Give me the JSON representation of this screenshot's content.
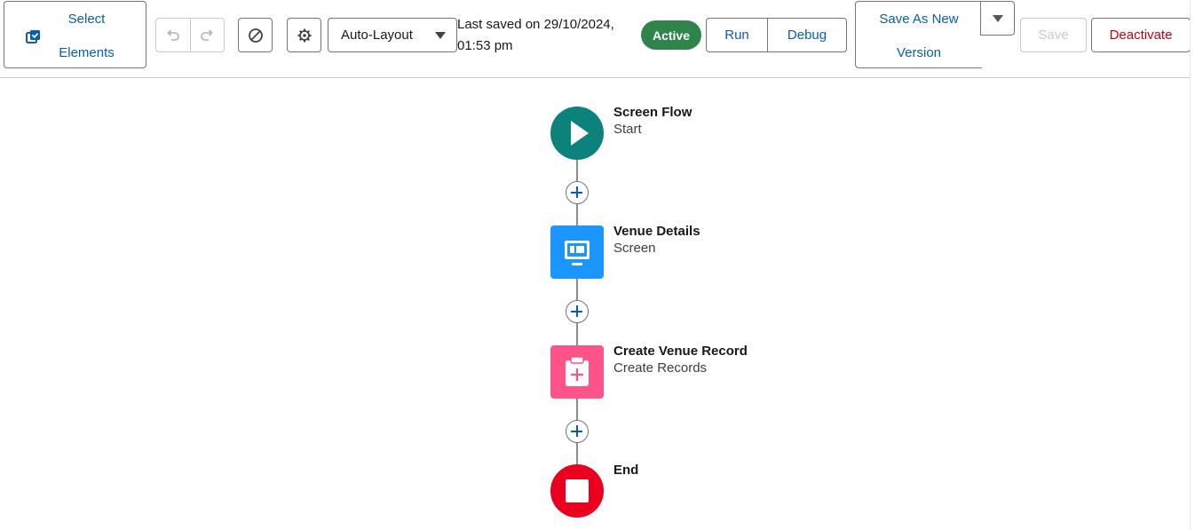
{
  "toolbar": {
    "select_elements": {
      "line1": "Select",
      "line2": "Elements"
    },
    "layout_select": {
      "selected": "Auto-Layout"
    },
    "last_saved": {
      "line1": "Last saved on 29/10/2024,",
      "line2": "01:53 pm"
    },
    "status_badge": "Active",
    "run_label": "Run",
    "debug_label": "Debug",
    "save_as_new": {
      "line1": "Save As New",
      "line2": "Version"
    },
    "save_label": "Save",
    "deactivate_label": "Deactivate",
    "colors": {
      "brand_blue": "#0b5cab",
      "active_green": "#2e844a",
      "danger_red": "#ba0517"
    },
    "icons": [
      "select-elements-icon",
      "undo-icon",
      "redo-icon",
      "ban-icon",
      "gear-icon",
      "chevron-down-icon"
    ]
  },
  "flow": {
    "nodes": [
      {
        "title": "Screen Flow",
        "subtitle": "Start",
        "icon": "play-icon",
        "color": "#0b827c"
      },
      {
        "title": "Venue Details",
        "subtitle": "Screen",
        "icon": "screen-icon",
        "color": "#1b96ff"
      },
      {
        "title": "Create Venue Record",
        "subtitle": "Create Records",
        "icon": "clipboard-plus-icon",
        "color": "#ff538a"
      },
      {
        "title": "End",
        "subtitle": "",
        "icon": "stop-icon",
        "color": "#ea001e"
      }
    ]
  }
}
